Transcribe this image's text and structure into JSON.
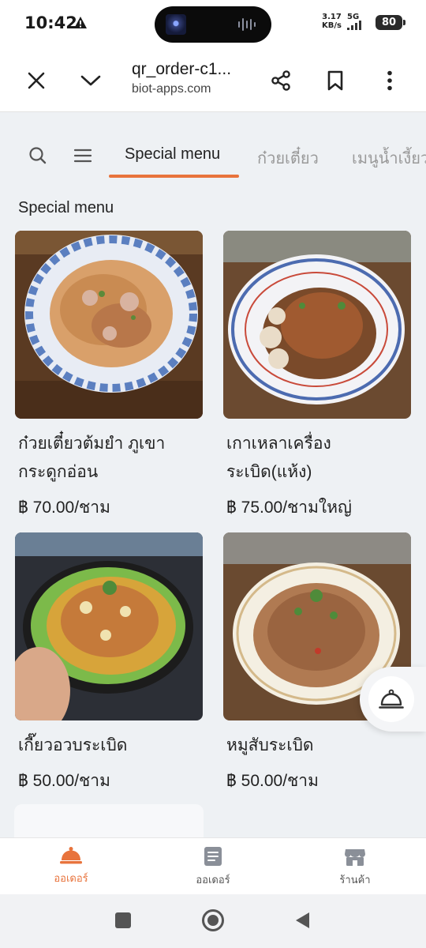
{
  "status_bar": {
    "time": "10:42",
    "net_speed_value": "3.17",
    "net_speed_unit": "KB/s",
    "network": "5G",
    "battery": "80"
  },
  "browser": {
    "title": "qr_order-c1...",
    "domain": "biot-apps.com"
  },
  "tabs": [
    "Special menu",
    "ก๋วยเตี๋ยว",
    "เมนูน้ำเงี้ยว"
  ],
  "section_title": "Special menu",
  "menu_items": [
    {
      "name": "ก๋วยเตี๋ยวต้มยำ ภูเขากระดูกอ่อน",
      "price": "฿ 70.00/ชาม"
    },
    {
      "name": "เกาเหลาเครื่องระเบิด(แห้ง)",
      "price": "฿ 75.00/ชามใหญ่"
    },
    {
      "name": "เกี๊ยวอวบระเบิด",
      "price": "฿ 50.00/ชาม"
    },
    {
      "name": "หมูสับระเบิด",
      "price": "฿ 50.00/ชาม"
    }
  ],
  "bottom_nav": [
    {
      "label": "ออเดอร์",
      "icon": "food-cloche-icon",
      "active": true
    },
    {
      "label": "ออเดอร์",
      "icon": "order-list-icon",
      "active": false
    },
    {
      "label": "ร้านค้า",
      "icon": "store-icon",
      "active": false
    }
  ],
  "colors": {
    "accent": "#e8733c",
    "inactive": "#8a8f98",
    "background": "#eef1f4"
  }
}
